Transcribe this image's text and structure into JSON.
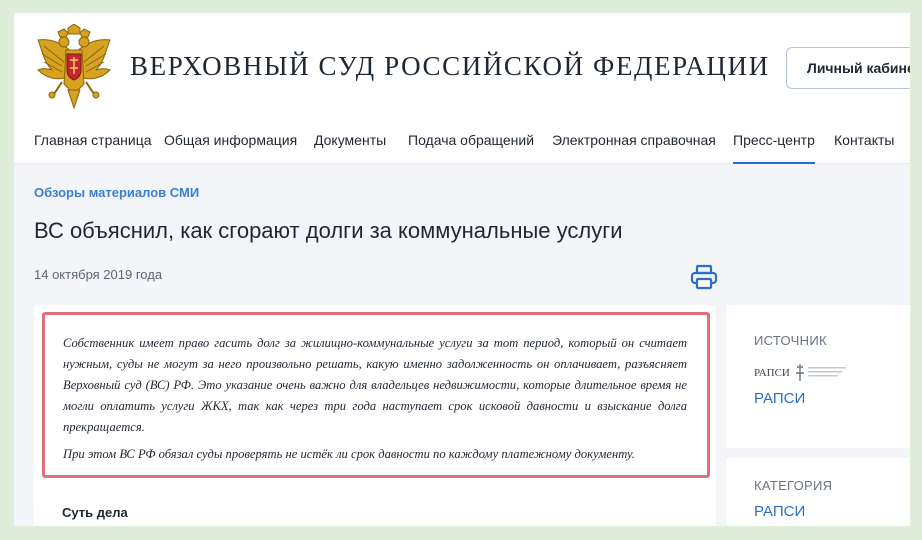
{
  "header": {
    "site_title": "ВЕРХОВНЫЙ СУД РОССИЙСКОЙ ФЕДЕРАЦИИ",
    "cabinet_label": "Личный кабинет"
  },
  "nav": {
    "items": [
      {
        "label": "Главная страница"
      },
      {
        "label": "Общая информация"
      },
      {
        "label": "Документы"
      },
      {
        "label": "Подача обращений"
      },
      {
        "label": "Электронная справочная"
      },
      {
        "label": "Пресс-центр",
        "active": true
      },
      {
        "label": "Контакты"
      }
    ]
  },
  "article": {
    "section": "Обзоры материалов СМИ",
    "title": "ВС объяснил, как сгорают долги за коммунальные услуги",
    "date": "14 октября 2019 года",
    "lead_paragraphs": [
      "Собственник имеет право гасить долг за жилищно-коммунальные услуги за тот период, который он считает нужным, суды не могут за него произвольно решать, какую именно задолженность он оплачивает, разъясняет Верховный суд (ВС) РФ. Это указание очень важно для владельцев недвижимости, которые длительное время не могли оплатить услуги ЖКХ, так как через три года наступает срок исковой давности и взыскание долга прекращается.",
      "При этом ВС РФ обязал суды проверять не истёк ли срок давности по каждому платежному документу."
    ],
    "essence_heading": "Суть дела"
  },
  "sidebar": {
    "source_label": "ИСТОЧНИК",
    "source_logo_text": "РАПСИ",
    "source_link": "РАПСИ",
    "category_label": "КАТЕГОРИЯ",
    "category_link": "РАПСИ"
  },
  "icons": {
    "emblem": "double-headed-eagle-emblem",
    "print": "printer-icon"
  },
  "colors": {
    "accent": "#2a6fc9",
    "highlight_border": "#e0717a",
    "section_link": "#3b7fd1",
    "background": "#f3f5f8"
  }
}
